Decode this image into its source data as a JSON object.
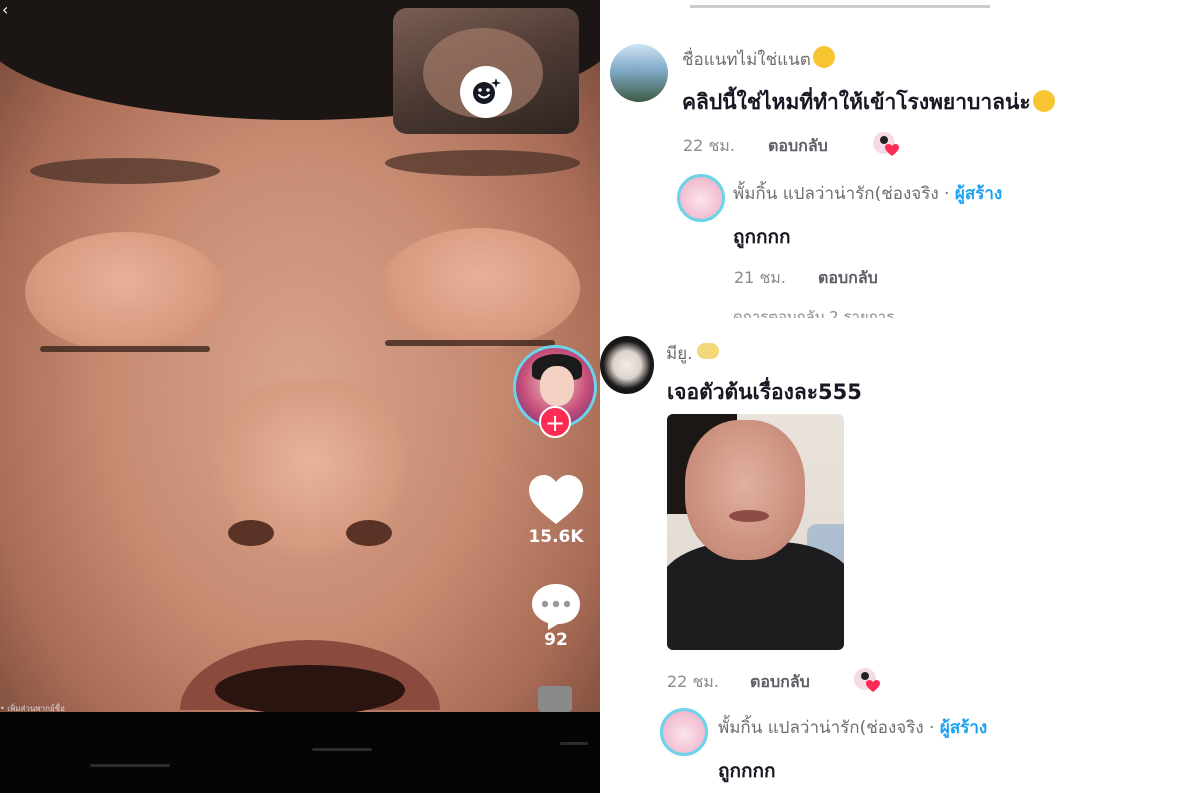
{
  "video": {
    "likes": "15.6K",
    "comments": "92",
    "caption": "• เพิ่มส่วนพากย์ชื่อ"
  },
  "comments": [
    {
      "username": "ชื่อแนทไม่ใช่แนต",
      "text": "คลิปนี้ใช่ไหมที่ทำให้เข้าโรงพยาบาลน่ะ",
      "time": "22 ชม.",
      "reply_label": "ตอบกลับ",
      "reply": {
        "username": "พั้มกิ้น แปลว่าน่ารัก(ช่องจริง",
        "separator": " · ",
        "creator_tag": "ผู้สร้าง",
        "text": "ถูกกกก",
        "time": "21 ชม.",
        "reply_label": "ตอบกลับ"
      },
      "view_more": "ดูการตอบกลับ 2 รายการ"
    },
    {
      "username": "มียู.",
      "text": "เจอตัวต้นเรื่องละ555",
      "time": "22 ชม.",
      "reply_label": "ตอบกลับ",
      "reply": {
        "username": "พั้มกิ้น แปลว่าน่ารัก(ช่องจริง",
        "separator": " · ",
        "creator_tag": "ผู้สร้าง",
        "text": "ถูกกกก"
      }
    }
  ],
  "icons": {
    "back": "chevron-left-icon",
    "effects": "smiley-sparkle-icon",
    "like": "heart-icon",
    "comment": "speech-bubble-icon",
    "follow": "plus-icon",
    "creator_liked": "creator-liked-heart-icon"
  },
  "colors": {
    "follow_red": "#fe2c55",
    "creator_blue": "#1da1f2",
    "avatar_ring": "#6ad4e8"
  }
}
